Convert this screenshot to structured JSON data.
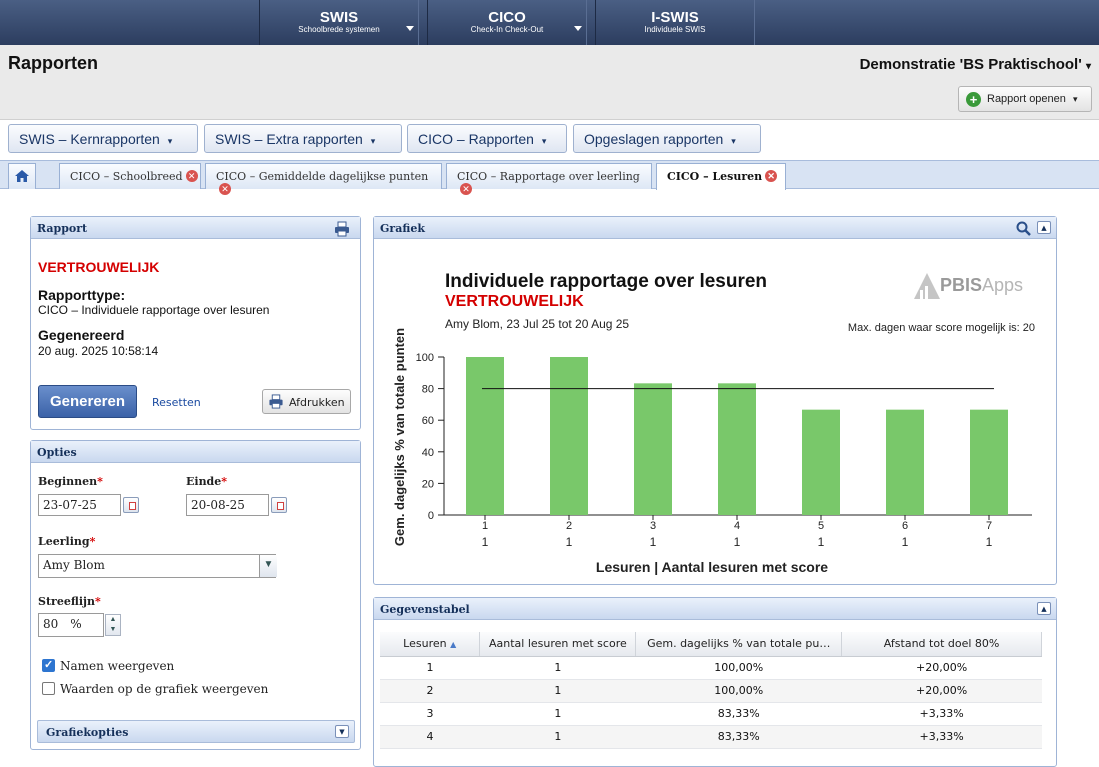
{
  "nav": {
    "items": [
      {
        "title": "SWIS",
        "subtitle": "Schoolbrede systemen"
      },
      {
        "title": "CICO",
        "subtitle": "Check-In Check-Out"
      },
      {
        "title": "I-SWIS",
        "subtitle": "Individuele SWIS"
      }
    ]
  },
  "header": {
    "title": "Rapporten",
    "school": "Demonstratie 'BS Praktischool'",
    "open_report_label": "Rapport openen"
  },
  "menus": [
    "SWIS – Kernrapporten",
    "SWIS – Extra rapporten",
    "CICO – Rapporten",
    "Opgeslagen rapporten"
  ],
  "tabs": [
    {
      "label": "CICO – Schoolbreed",
      "active": false
    },
    {
      "label": "CICO – Gemiddelde dagelijkse punten",
      "active": false
    },
    {
      "label": "CICO – Rapportage over leerling",
      "active": false
    },
    {
      "label": "CICO – Lesuren",
      "active": true
    }
  ],
  "report_panel": {
    "title": "Rapport",
    "confidential": "VERTROUWELIJK",
    "type_label": "Rapporttype:",
    "type_value": "CICO – Individuele rapportage over lesuren",
    "generated_label": "Gegenereerd",
    "generated_value": "20 aug. 2025 10:58:14",
    "generate_button": "Genereren",
    "reset_link": "Resetten",
    "print_button": "Afdrukken"
  },
  "options_panel": {
    "title": "Opties",
    "start_label": "Beginnen",
    "start_value": "23-07-25",
    "end_label": "Einde",
    "end_value": "20-08-25",
    "student_label": "Leerling",
    "student_value": "Amy Blom",
    "goal_label": "Streeflijn",
    "goal_value": "80",
    "goal_unit": "%",
    "required_mark": "*",
    "show_names_label": "Namen weergeven",
    "show_names_checked": true,
    "show_values_label": "Waarden op de grafiek weergeven",
    "show_values_checked": false,
    "graph_options_title": "Grafiekopties"
  },
  "graph_panel": {
    "title": "Grafiek",
    "logo_text_bold": "PBIS",
    "logo_text_light": "Apps"
  },
  "chart_data": {
    "type": "bar",
    "title": "Individuele rapportage over lesuren",
    "subtitle": "VERTROUWELIJK",
    "info_line": "Amy Blom, 23 Jul 25 tot 20 Aug 25",
    "note": "Max. dagen waar score mogelijk is: 20",
    "xlabel": "Lesuren | Aantal lesuren met score",
    "ylabel": "Gem. dagelijks % van totale punten",
    "categories": [
      "1",
      "2",
      "3",
      "4",
      "5",
      "6",
      "7"
    ],
    "category_counts": [
      "1",
      "1",
      "1",
      "1",
      "1",
      "1",
      "1"
    ],
    "values": [
      100,
      100,
      83.33,
      83.33,
      66.67,
      66.67,
      66.67
    ],
    "goal_line": 80,
    "ylim": [
      0,
      100
    ],
    "yticks": [
      0,
      20,
      40,
      60,
      80,
      100
    ],
    "bar_color": "#79c86a"
  },
  "data_table": {
    "title": "Gegevenstabel",
    "columns": [
      "Lesuren",
      "Aantal lesuren met score",
      "Gem. dagelijks % van totale pu…",
      "Afstand tot doel 80%"
    ],
    "rows": [
      [
        "1",
        "1",
        "100,00%",
        "+20,00%"
      ],
      [
        "2",
        "1",
        "100,00%",
        "+20,00%"
      ],
      [
        "3",
        "1",
        "83,33%",
        "+3,33%"
      ],
      [
        "4",
        "1",
        "83,33%",
        "+3,33%"
      ]
    ]
  }
}
